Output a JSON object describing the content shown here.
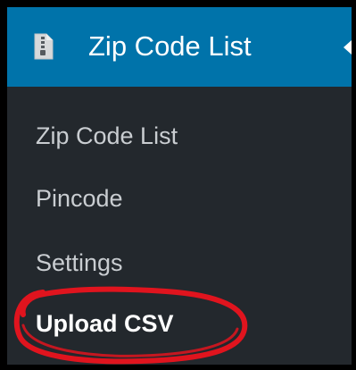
{
  "menu": {
    "title": "Zip Code List",
    "icon": "document-icon",
    "header_color": "#0073aa",
    "background_color": "#23282d",
    "items": [
      {
        "label": "Zip Code List",
        "current": false
      },
      {
        "label": "Pincode",
        "current": false
      },
      {
        "label": "Settings",
        "current": false
      },
      {
        "label": "Upload CSV",
        "current": true
      }
    ]
  },
  "annotation": {
    "type": "hand-drawn ellipse",
    "color": "#e0141e",
    "target": "Upload CSV"
  }
}
